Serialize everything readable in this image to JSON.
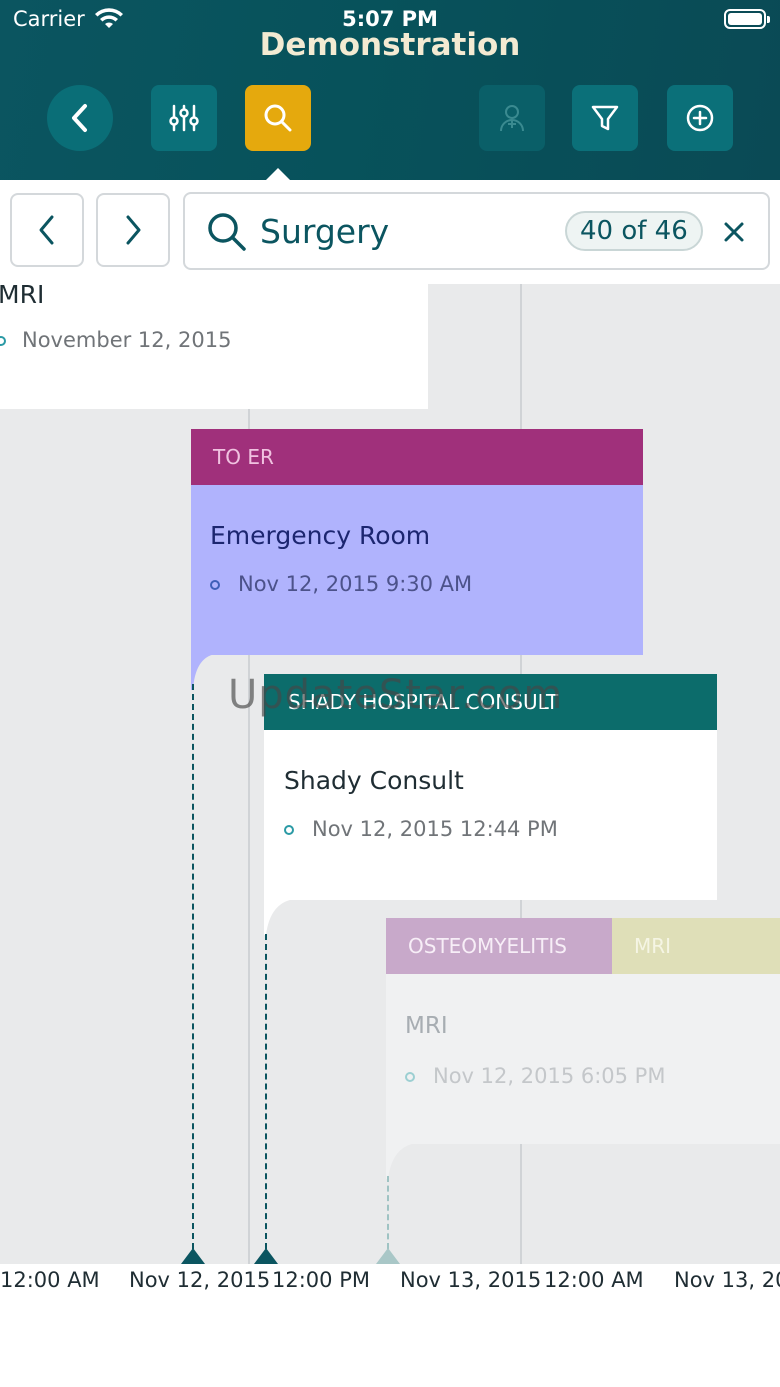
{
  "status_bar": {
    "carrier": "Carrier",
    "time": "5:07 PM"
  },
  "header": {
    "title": "Demonstration"
  },
  "toolbar": {
    "back_icon": "chevron-left-icon",
    "adjust_icon": "sliders-icon",
    "search_icon": "search-icon",
    "person_icon": "person-add-icon",
    "filter_icon": "filter-icon",
    "add_icon": "plus-circle-icon",
    "search_active_color": "#e5a90d"
  },
  "search": {
    "query": "Surgery",
    "match_count": "40 of 46"
  },
  "events": [
    {
      "header": "",
      "title": "MRI",
      "date": "November 12, 2015"
    },
    {
      "header": "TO ER",
      "title": "Emergency Room",
      "date": "Nov 12, 2015 9:30 AM",
      "header_color": "#a0307b",
      "body_color": "#b0b3fd"
    },
    {
      "header": "SHADY HOSPITAL CONSULT",
      "title": "Shady Consult",
      "date": "Nov 12, 2015 12:44 PM",
      "header_color": "#0c6c6b"
    },
    {
      "header": "OSTEOMYELITIS",
      "header2": "MRI",
      "title": "MRI",
      "date": "Nov 12, 2015 6:05 PM",
      "header_color": "#c8a9ca",
      "header2_color": "#dfdfb8"
    }
  ],
  "watermark": "UpdateStar.com",
  "axis": {
    "ticks": [
      "12:00 AM",
      "Nov 12, 2015",
      "12:00 PM",
      "Nov 13, 2015",
      "12:00 AM",
      "Nov 13, 20"
    ]
  }
}
